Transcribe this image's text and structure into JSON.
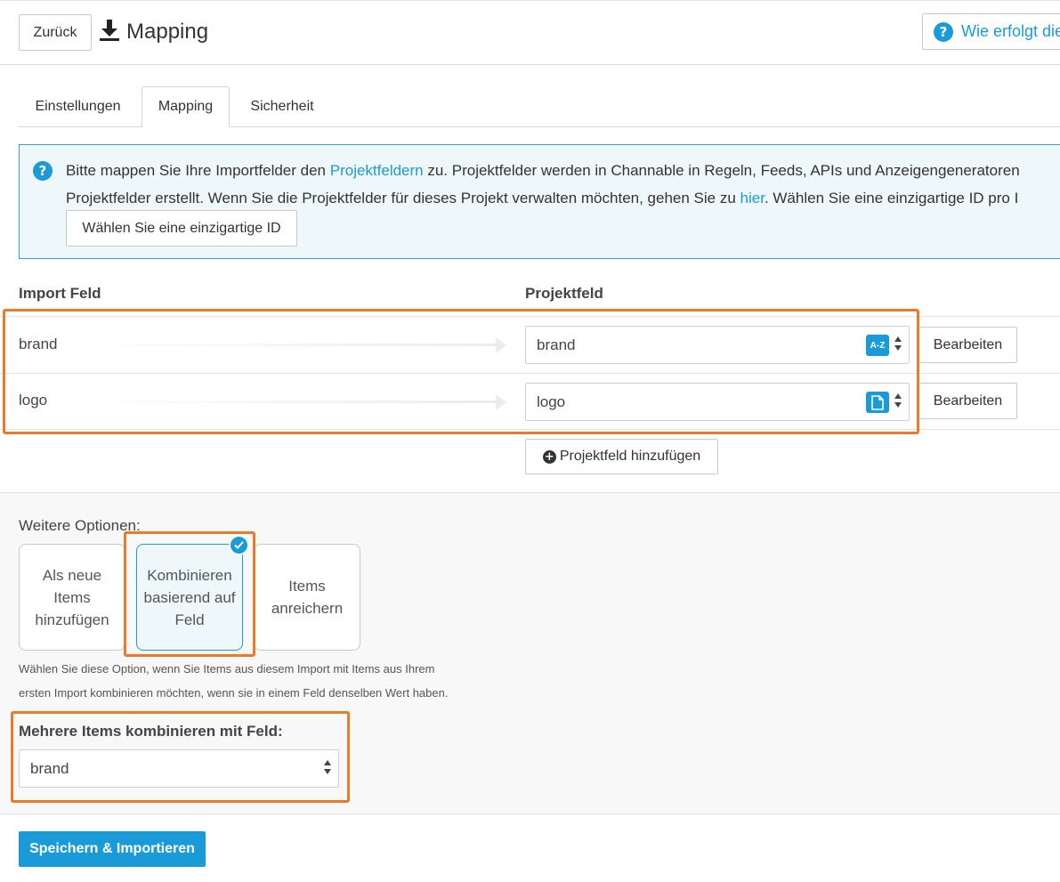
{
  "header": {
    "back_label": "Zurück",
    "title": "Mapping",
    "title_icon": "download-icon",
    "help_label": "Wie erfolgt die"
  },
  "tabs": [
    {
      "label": "Einstellungen",
      "active": false
    },
    {
      "label": "Mapping",
      "active": true
    },
    {
      "label": "Sicherheit",
      "active": false
    }
  ],
  "info": {
    "line1_pre": "Bitte mappen Sie Ihre Importfelder den ",
    "line1_link": "Projektfeldern",
    "line1_post": " zu. Projektfelder werden in Channable in Regeln, Feeds, APIs und Anzeigengeneratoren",
    "line2_pre": "Projektfelder erstellt. Wenn Sie die Projektfelder für dieses Projekt verwalten möchten, gehen Sie zu ",
    "line2_link": "hier",
    "line2_post": ". Wählen Sie eine einzigartige ID pro I",
    "unique_button": "Wählen Sie eine einzigartige ID"
  },
  "mapping": {
    "col_import": "Import Feld",
    "col_project": "Projektfeld",
    "rows": [
      {
        "import": "brand",
        "project": "brand",
        "type_icon": "text-az-icon",
        "type_text": "A-Z",
        "edit": "Bearbeiten"
      },
      {
        "import": "logo",
        "project": "logo",
        "type_icon": "file-icon",
        "edit": "Bearbeiten"
      }
    ],
    "add_field": "Projektfeld hinzufügen"
  },
  "options": {
    "title": "Weitere Optionen:",
    "cards": [
      {
        "label": "Als neue Items hinzufügen",
        "selected": false
      },
      {
        "label": "Kombinieren basierend auf Feld",
        "selected": true
      },
      {
        "label": "Items anreichern",
        "selected": false
      }
    ],
    "description_line1": "Wählen Sie diese Option, wenn Sie Items aus diesem Import mit Items aus Ihrem",
    "description_line2": "ersten Import kombinieren möchten, wenn sie in einem Feld denselben Wert haben.",
    "combine_label": "Mehrere Items kombinieren mit Feld:",
    "combine_value": "brand"
  },
  "footer": {
    "save_label": "Speichern & Importieren"
  },
  "colors": {
    "accent": "#1a9bd7",
    "highlight": "#ec7a2a"
  }
}
